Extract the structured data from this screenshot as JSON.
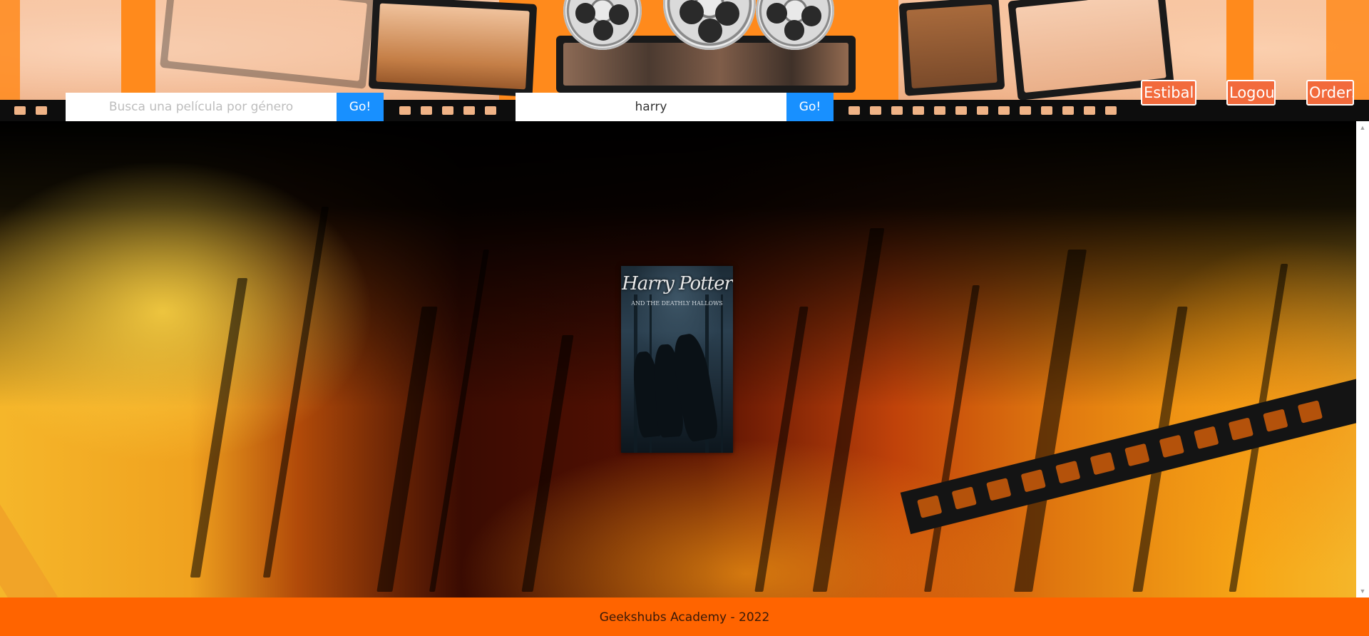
{
  "header": {
    "genre_search": {
      "placeholder": "Busca una película por género",
      "value": "",
      "button_label": "Go!"
    },
    "title_search": {
      "placeholder": "",
      "value": "harry",
      "button_label": "Go!"
    },
    "nav": {
      "user_label": "Estibaliz",
      "logout_label": "Logout",
      "orders_label": "Orders"
    }
  },
  "results": [
    {
      "title": "Harry Potter",
      "subtitle": "AND THE DEATHLY HALLOWS"
    }
  ],
  "footer": {
    "text": "Geekshubs Academy - 2022"
  },
  "colors": {
    "footer_bg": "#ff6400",
    "go_button": "#1890ff",
    "nav_button": "#f26a3c"
  },
  "icons": {
    "scroll_up": "triangle-up-icon",
    "scroll_down": "triangle-down-icon"
  }
}
